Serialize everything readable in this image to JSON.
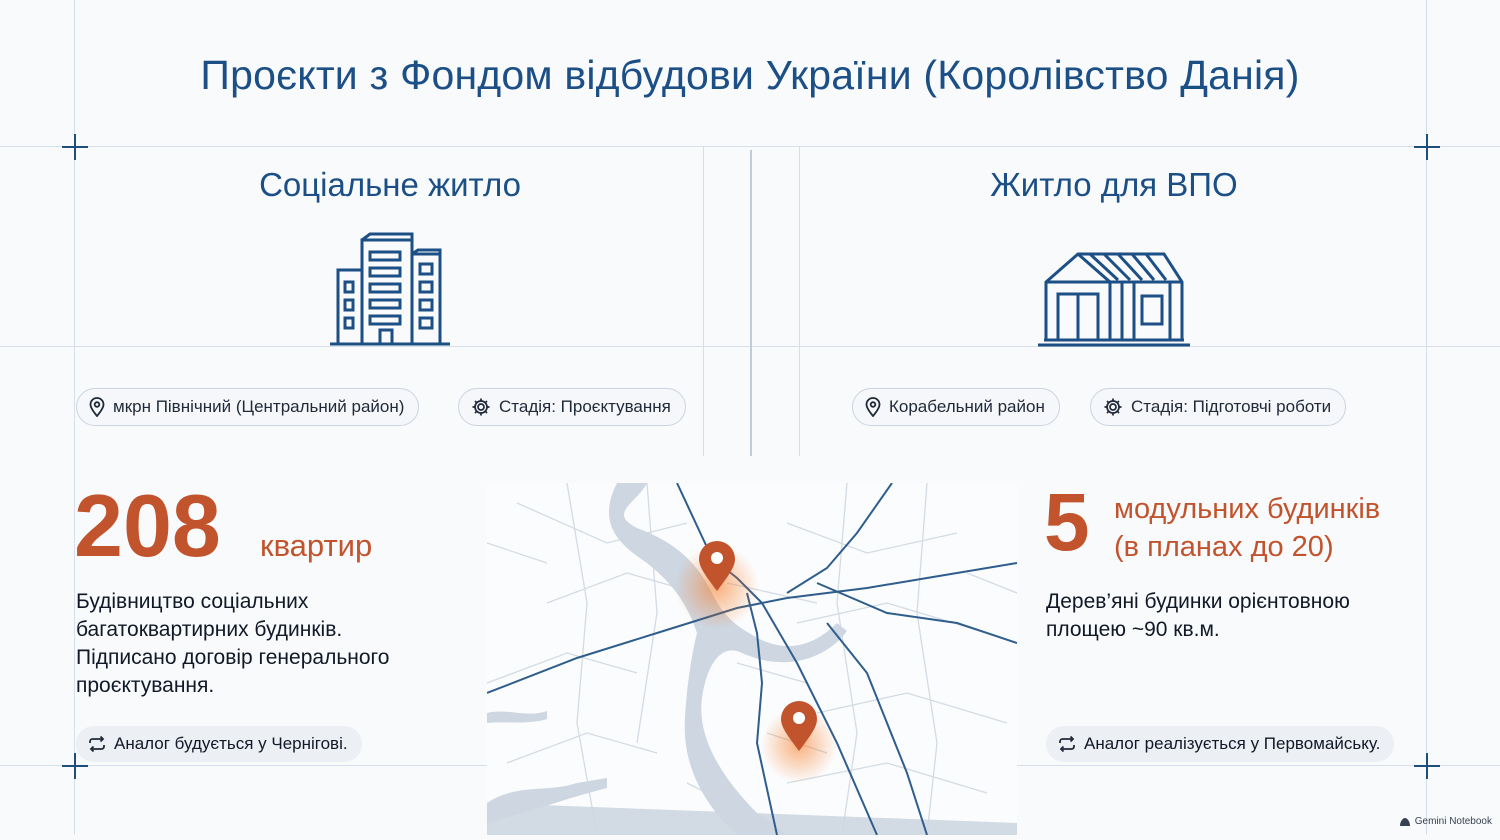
{
  "title": "Проєкти з Фондом відбудови України (Королівство Данія)",
  "left": {
    "heading": "Соціальне житло",
    "icon": "apartment-building-icon",
    "location": "мкрн Північний (Центральний район)",
    "stage": "Стадія: Проєктування",
    "number": "208",
    "unit": "квартир",
    "description": [
      "Будівництво соціальних",
      "багатоквартирних будинків.",
      "Підписано договір генерального",
      "проєктування."
    ],
    "analog": "Аналог будується у Чернігові."
  },
  "right": {
    "heading": "Житло для ВПО",
    "icon": "modular-house-icon",
    "location": "Корабельний район",
    "stage": "Стадія: Підготовчі роботи",
    "number": "5",
    "unit_line1": "модульних будинків",
    "unit_line2": "(в планах до 20)",
    "description": [
      "Дерев’яні будинки орієнтовною",
      "площею ~90 кв.м."
    ],
    "analog": "Аналог реалізується у Первомайську."
  },
  "watermark": "Gemini Notebook",
  "colors": {
    "accent": "#c2542d",
    "primary": "#1c4f85",
    "map_road": "#2f5d8c",
    "map_water": "#cfd8e3"
  }
}
